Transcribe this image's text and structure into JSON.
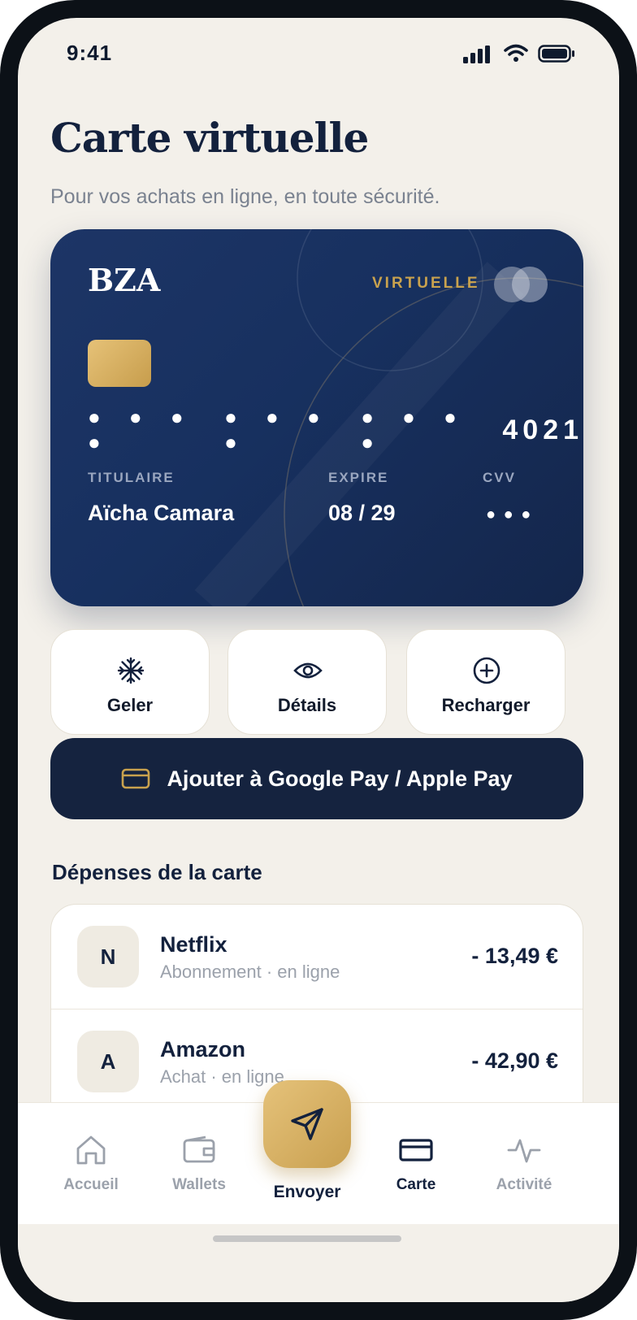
{
  "status": {
    "time": "9:41"
  },
  "header": {
    "title": "Carte virtuelle",
    "subtitle": "Pour vos achats en ligne, en toute sécurité."
  },
  "card": {
    "brand": "BZA",
    "type_label": "VIRTUELLE",
    "masked_groups": [
      "● ● ● ●",
      "● ● ● ●",
      "● ● ● ●"
    ],
    "last4": "4021",
    "holder_label": "TITULAIRE",
    "holder_name": "Aïcha Camara",
    "expiry_label": "EXPIRE",
    "expiry_value": "08 / 29",
    "cvv_label": "CVV",
    "cvv_value": "● ● ●"
  },
  "actions": [
    {
      "label": "Geler",
      "icon": "snowflake-icon"
    },
    {
      "label": "Détails",
      "icon": "eye-icon"
    },
    {
      "label": "Recharger",
      "icon": "plus-circle-icon"
    }
  ],
  "wallet_button": {
    "label": "Ajouter à Google Pay / Apple Pay",
    "icon": "card-icon"
  },
  "spending": {
    "title": "Dépenses de la carte",
    "items": [
      {
        "initial": "N",
        "name": "Netflix",
        "meta": "Abonnement · en ligne",
        "amount": "- 13,49 €"
      },
      {
        "initial": "A",
        "name": "Amazon",
        "meta": "Achat · en ligne",
        "amount": "- 42,90 €"
      }
    ]
  },
  "nav": {
    "items": [
      {
        "label": "Accueil",
        "icon": "home-icon"
      },
      {
        "label": "Wallets",
        "icon": "wallet-icon"
      },
      {
        "label": "Envoyer",
        "icon": "send-icon"
      },
      {
        "label": "Carte",
        "icon": "card-icon"
      },
      {
        "label": "Activité",
        "icon": "activity-icon"
      }
    ],
    "active": "Carte"
  },
  "colors": {
    "background": "#f3f0ea",
    "navy": "#13213d",
    "gold": "#c9a24e",
    "card_gradient_start": "#1d3566",
    "card_gradient_end": "#14264b"
  }
}
